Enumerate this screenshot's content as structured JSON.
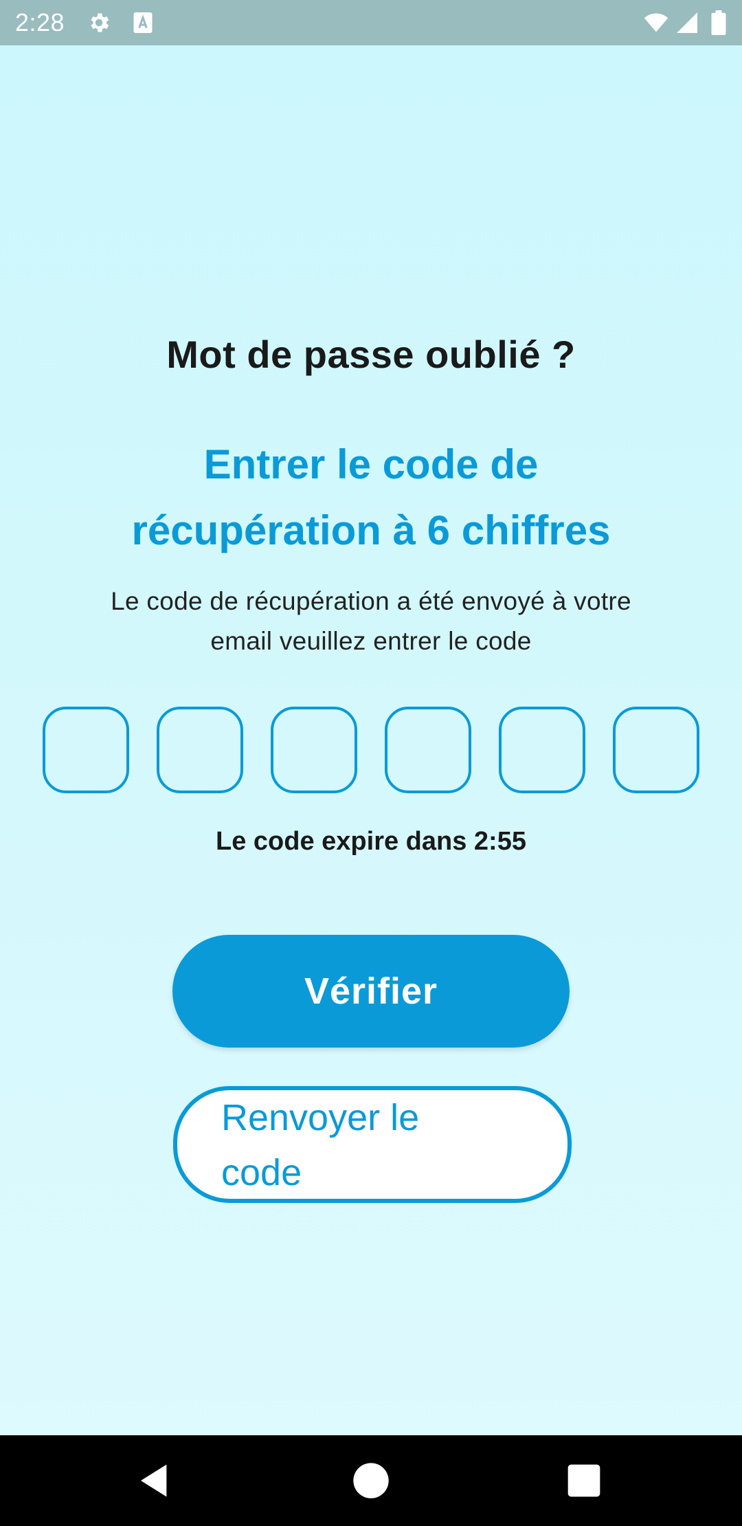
{
  "status_bar": {
    "time": "2:28",
    "icons": [
      "gear-icon",
      "keyboard-a-icon",
      "wifi-icon",
      "signal-icon",
      "battery-icon"
    ]
  },
  "screen": {
    "title": "Mot de passe oublié ?",
    "subtitle_line1": "Entrer le code de",
    "subtitle_line2": "récupération à 6 chiffres",
    "description_line1": "Le code de récupération a été envoyé à votre",
    "description_line2": "email veuillez entrer le code",
    "otp_digits": [
      "",
      "",
      "",
      "",
      "",
      ""
    ],
    "expire_text": "Le code expire dans 2:55",
    "verify_button": "Vérifier",
    "resend_button_line1": "Renvoyer le",
    "resend_button_line2": "code"
  },
  "nav_bar": {
    "icons": [
      "back-icon",
      "home-icon",
      "recents-icon"
    ]
  },
  "colors": {
    "accent": "#0a9ad8",
    "background": "#ccf7fd",
    "status_bar": "#99bcbe",
    "title_text": "#1a1a1a"
  }
}
